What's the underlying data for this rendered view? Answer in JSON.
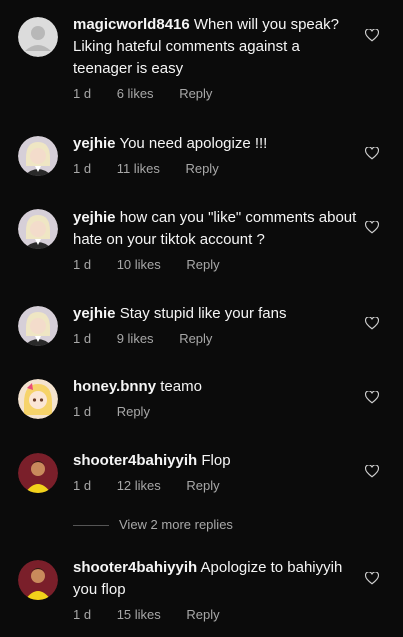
{
  "comments": [
    {
      "user": "magicworld8416",
      "text": "When will you speak? Liking hateful comments against a teenager is easy",
      "time": "1 d",
      "likes": "6 likes",
      "reply": "Reply",
      "avatar": "default-avatar"
    },
    {
      "user": "yejhie",
      "text": "You need apologize !!!",
      "time": "1 d",
      "likes": "11 likes",
      "reply": "Reply",
      "avatar": "blonde-girl-avatar"
    },
    {
      "user": "yejhie",
      "text": "how can you \"like\" comments about hate on your tiktok account ?",
      "time": "1 d",
      "likes": "10 likes",
      "reply": "Reply",
      "avatar": "blonde-girl-avatar"
    },
    {
      "user": "yejhie",
      "text": "Stay stupid like your fans",
      "time": "1 d",
      "likes": "9 likes",
      "reply": "Reply",
      "avatar": "blonde-girl-avatar"
    },
    {
      "user": "honey.bnny",
      "text": "teamo",
      "time": "1 d",
      "likes": "",
      "reply": "Reply",
      "avatar": "anime-girl-avatar"
    },
    {
      "user": "shooter4bahiyyih",
      "text": "Flop",
      "time": "1 d",
      "likes": "12 likes",
      "reply": "Reply",
      "avatar": "yellow-shirt-avatar"
    },
    {
      "user": "shooter4bahiyyih",
      "text": "Apologize to bahiyyih you flop",
      "time": "1 d",
      "likes": "15 likes",
      "reply": "Reply",
      "avatar": "yellow-shirt-avatar"
    }
  ],
  "view_more_replies": "View 2 more replies",
  "colors": {
    "background": "#0b0b0b",
    "text": "#f5f5f5",
    "muted": "#a8a8a8"
  }
}
